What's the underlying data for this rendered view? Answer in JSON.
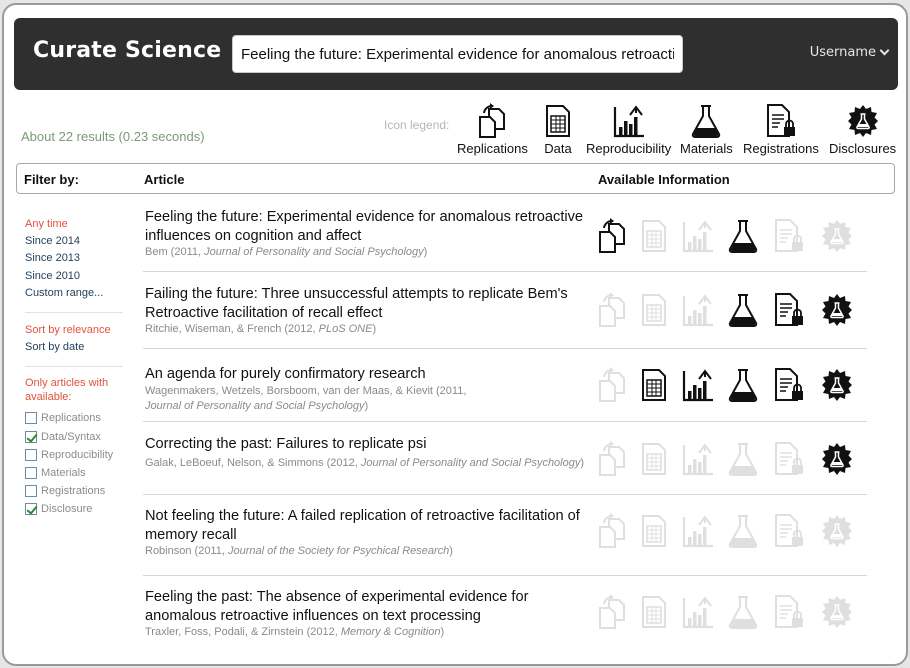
{
  "app": {
    "brand": "Curate Science",
    "username": "Username"
  },
  "search": {
    "value": "Feeling the future: Experimental evidence for anomalous retroactiv"
  },
  "results": {
    "summary": "About 22 results (0.23 seconds)"
  },
  "legend": {
    "title": "Icon legend:",
    "items": [
      {
        "icon": "replications-icon",
        "label": "Replications"
      },
      {
        "icon": "data-icon",
        "label": "Data"
      },
      {
        "icon": "reproducibility-icon",
        "label": "Reproducibility"
      },
      {
        "icon": "materials-icon",
        "label": "Materials"
      },
      {
        "icon": "registrations-icon",
        "label": "Registrations"
      },
      {
        "icon": "disclosures-icon",
        "label": "Disclosures"
      }
    ]
  },
  "table": {
    "filter_header": "Filter by:",
    "article_header": "Article",
    "info_header": "Available Information"
  },
  "filters": {
    "time": [
      "Any time",
      "Since 2014",
      "Since 2013",
      "Since 2010",
      "Custom range..."
    ],
    "time_active": "Any time",
    "sort": [
      "Sort by relevance",
      "Sort by date"
    ],
    "availability_note": "Only articles with available:",
    "availability": [
      {
        "label": "Replications",
        "checked": false
      },
      {
        "label": "Data/Syntax",
        "checked": true
      },
      {
        "label": "Reproducibility",
        "checked": false
      },
      {
        "label": "Materials",
        "checked": false
      },
      {
        "label": "Registrations",
        "checked": false
      },
      {
        "label": "Disclosure",
        "checked": true
      }
    ]
  },
  "articles": [
    {
      "title": "Feeling the future: Experimental evidence for anomalous retroactive influences on cognition and affect",
      "authors": "Bem (2011, ",
      "journal": "Journal of Personality and Social Psychology",
      "close": ")",
      "available": {
        "replications": true,
        "data": false,
        "reproducibility": false,
        "materials": true,
        "registrations": false,
        "disclosures": false
      }
    },
    {
      "title": "Failing the future: Three unsuccessful attempts to replicate Bem's Retroactive facilitation of recall effect",
      "authors": "Ritchie, Wiseman, & French (2012, ",
      "journal": "PLoS ONE",
      "close": ")",
      "available": {
        "replications": false,
        "data": false,
        "reproducibility": false,
        "materials": true,
        "registrations": true,
        "disclosures": true
      }
    },
    {
      "title": "An agenda for purely confirmatory research",
      "authors": "Wagenmakers, Wetzels, Borsboom, van der Maas, & Kievit (2011,",
      "journal": "Journal of Personality and Social Psychology",
      "close": ")",
      "available": {
        "replications": false,
        "data": true,
        "reproducibility": true,
        "materials": true,
        "registrations": true,
        "disclosures": true
      }
    },
    {
      "title": "Correcting the past: Failures to replicate psi",
      "authors": "Galak, LeBoeuf, Nelson, & Simmons (2012, ",
      "journal": "Journal of Personality and Social Psychology",
      "close": ")",
      "available": {
        "replications": false,
        "data": false,
        "reproducibility": false,
        "materials": false,
        "registrations": false,
        "disclosures": true
      }
    },
    {
      "title": "Not feeling the future: A failed replication of retroactive facilitation of memory recall",
      "authors": "Robinson (2011, ",
      "journal": "Journal of the Society for Psychical Research",
      "close": ")",
      "available": {
        "replications": false,
        "data": false,
        "reproducibility": false,
        "materials": false,
        "registrations": false,
        "disclosures": false
      }
    },
    {
      "title": "Feeling the past: The absence of experimental evidence for anomalous retroactive influences on text processing",
      "authors": "Traxler, Foss, Podali, & Zirnstein (2012, ",
      "journal": "Memory & Cognition",
      "close": ")",
      "available": {
        "replications": false,
        "data": false,
        "reproducibility": false,
        "materials": false,
        "registrations": false,
        "disclosures": false
      }
    }
  ]
}
